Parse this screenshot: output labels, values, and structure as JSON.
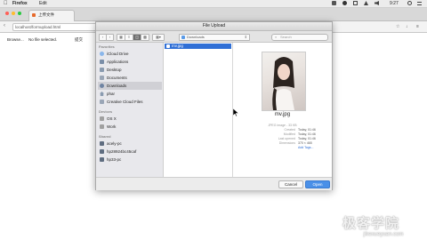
{
  "menubar": {
    "app": "Firefox",
    "edit": "Edit",
    "clock": "9:27"
  },
  "browser": {
    "tab_title": "上传文件",
    "url": "localhost/formupload.html"
  },
  "page": {
    "browse_label": "Browse...",
    "no_file": "No file selected.",
    "submit_label": "提交"
  },
  "dialog": {
    "title": "File Upload",
    "location": "Downloads",
    "search_placeholder": "Search",
    "sidebar": {
      "favorites_header": "Favorites",
      "favorites": [
        {
          "label": "iCloud Drive",
          "icon": "cloud-icon"
        },
        {
          "label": "Applications",
          "icon": "applications-icon"
        },
        {
          "label": "Desktop",
          "icon": "desktop-icon"
        },
        {
          "label": "Documents",
          "icon": "documents-icon"
        },
        {
          "label": "Downloads",
          "icon": "downloads-icon"
        },
        {
          "label": "phar",
          "icon": "home-icon"
        },
        {
          "label": "Creative Cloud Files",
          "icon": "creative-cloud-icon"
        }
      ],
      "devices_header": "Devices",
      "devices": [
        {
          "label": "OS X",
          "icon": "disk-icon"
        },
        {
          "label": "Work",
          "icon": "disk-icon"
        }
      ],
      "shared_header": "Shared",
      "shared": [
        {
          "label": "acely-pc",
          "icon": "computer-icon"
        },
        {
          "label": "hp28924bc45caf",
          "icon": "computer-icon"
        },
        {
          "label": "hp33-pc",
          "icon": "computer-icon"
        }
      ]
    },
    "file": {
      "name": "mv.jpg"
    },
    "preview": {
      "filename": "mv.jpg",
      "kind": "JPEG image - 33 KB",
      "created_label": "Created",
      "created": "Today, 01:46",
      "modified_label": "Modified",
      "modified": "Today, 01:46",
      "last_opened_label": "Last opened",
      "last_opened": "Today, 01:46",
      "dimensions_label": "Dimensions",
      "dimensions": "370 × 465",
      "add_tags": "Add Tags..."
    },
    "cancel_label": "Cancel",
    "open_label": "Open"
  },
  "watermark": {
    "main": "极客学院",
    "sub": "jikexueyuan.com"
  },
  "colors": {
    "accent": "#2f6fd6",
    "open_button": "#4a90e8"
  }
}
